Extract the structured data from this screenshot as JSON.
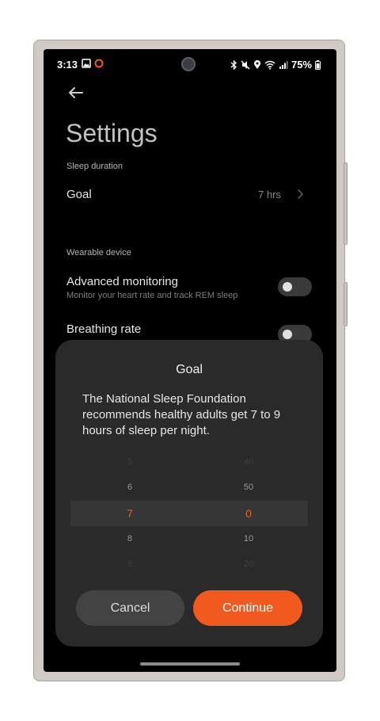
{
  "status_bar": {
    "time": "3:13",
    "battery": "75%",
    "icons_left": [
      "image-icon",
      "record-icon"
    ],
    "icons_right": [
      "bluetooth-icon",
      "mute-icon",
      "location-icon",
      "wifi-icon",
      "signal-icon",
      "battery-icon"
    ]
  },
  "settings": {
    "title": "Settings",
    "sleep_section": "Sleep duration",
    "goal_label": "Goal",
    "goal_value": "7 hrs",
    "wearable_section": "Wearable device",
    "advanced_monitoring": {
      "title": "Advanced monitoring",
      "subtitle": "Monitor your heart rate and track REM sleep",
      "enabled": false
    },
    "breathing_rate": {
      "title": "Breathing rate",
      "enabled": false
    }
  },
  "dialog": {
    "title": "Goal",
    "description": "The National Sleep Foundation recommends healthy adults get 7 to 9 hours of sleep per night.",
    "hours": [
      "5",
      "6",
      "7",
      "8",
      "9"
    ],
    "minutes": [
      "40",
      "50",
      "0",
      "10",
      "20"
    ],
    "selected_hours": "7",
    "selected_minutes": "0",
    "cancel_label": "Cancel",
    "continue_label": "Continue"
  },
  "colors": {
    "accent": "#f05a1e",
    "background": "#000000",
    "sheet": "#2a2a2a"
  }
}
